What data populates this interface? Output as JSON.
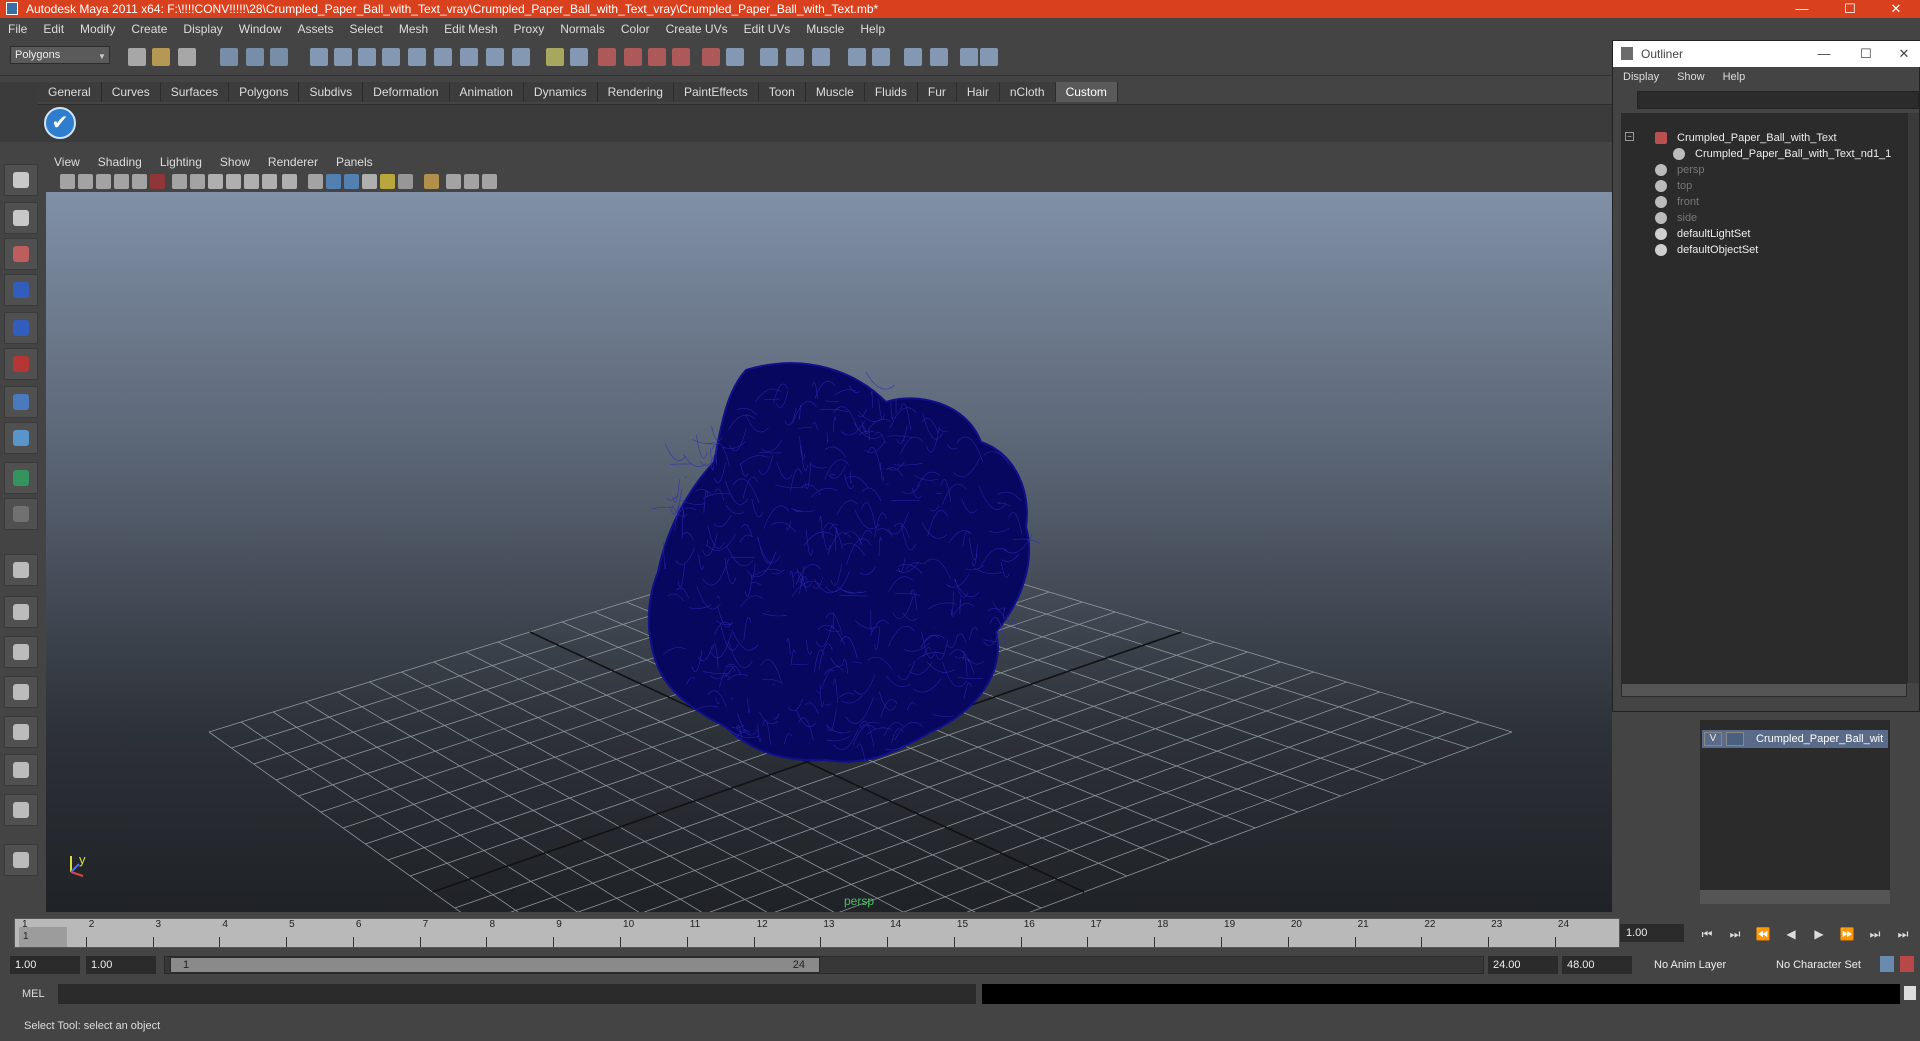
{
  "window": {
    "title": "Autodesk Maya 2011 x64: F:\\!!!!CONV!!!!!\\28\\Crumpled_Paper_Ball_with_Text_vray\\Crumpled_Paper_Ball_with_Text_vray\\Crumpled_Paper_Ball_with_Text.mb*",
    "minimize": "—",
    "maximize": "☐",
    "close": "✕"
  },
  "menubar": [
    "File",
    "Edit",
    "Modify",
    "Create",
    "Display",
    "Window",
    "Assets",
    "Select",
    "Mesh",
    "Edit Mesh",
    "Proxy",
    "Normals",
    "Color",
    "Create UVs",
    "Edit UVs",
    "Muscle",
    "Help"
  ],
  "toolbar": {
    "mode": "Polygons"
  },
  "shelf": {
    "tabs": [
      "General",
      "Curves",
      "Surfaces",
      "Polygons",
      "Subdivs",
      "Deformation",
      "Animation",
      "Dynamics",
      "Rendering",
      "PaintEffects",
      "Toon",
      "Muscle",
      "Fluids",
      "Fur",
      "Hair",
      "nCloth",
      "Custom"
    ],
    "active": "Custom"
  },
  "panel": {
    "menu": [
      "View",
      "Shading",
      "Lighting",
      "Show",
      "Renderer",
      "Panels"
    ],
    "camera_label": "persp"
  },
  "outliner": {
    "title": "Outliner",
    "menu": [
      "Display",
      "Show",
      "Help"
    ],
    "items": [
      {
        "label": "Crumpled_Paper_Ball_with_Text",
        "dim": false
      },
      {
        "label": "Crumpled_Paper_Ball_with_Text_nd1_1",
        "dim": false
      },
      {
        "label": "persp",
        "dim": true
      },
      {
        "label": "top",
        "dim": true
      },
      {
        "label": "front",
        "dim": true
      },
      {
        "label": "side",
        "dim": true
      },
      {
        "label": "defaultLightSet",
        "dim": false
      },
      {
        "label": "defaultObjectSet",
        "dim": false
      }
    ]
  },
  "layers": {
    "visible_flag": "V",
    "name": "Crumpled_Paper_Ball_wit"
  },
  "timeline": {
    "ticks": [
      "1",
      "2",
      "3",
      "4",
      "5",
      "6",
      "7",
      "8",
      "9",
      "10",
      "11",
      "12",
      "13",
      "14",
      "15",
      "16",
      "17",
      "18",
      "19",
      "20",
      "21",
      "22",
      "23",
      "24"
    ],
    "current_frame": "1.00",
    "current_marker": "1"
  },
  "range": {
    "start": "1.00",
    "anim_start": "1.00",
    "slider_start": "1",
    "slider_end": "24",
    "end": "24.00",
    "anim_end": "48.00",
    "anim_layer": "No Anim Layer",
    "character_set": "No Character Set"
  },
  "command": {
    "label": "MEL"
  },
  "help": {
    "text": "Select Tool: select an object"
  },
  "colors": {
    "title_bar": "#d9411e",
    "mesh_wire": "#0a0a7a",
    "viewport_top": "#8090a6",
    "viewport_bottom": "#1f2226"
  }
}
